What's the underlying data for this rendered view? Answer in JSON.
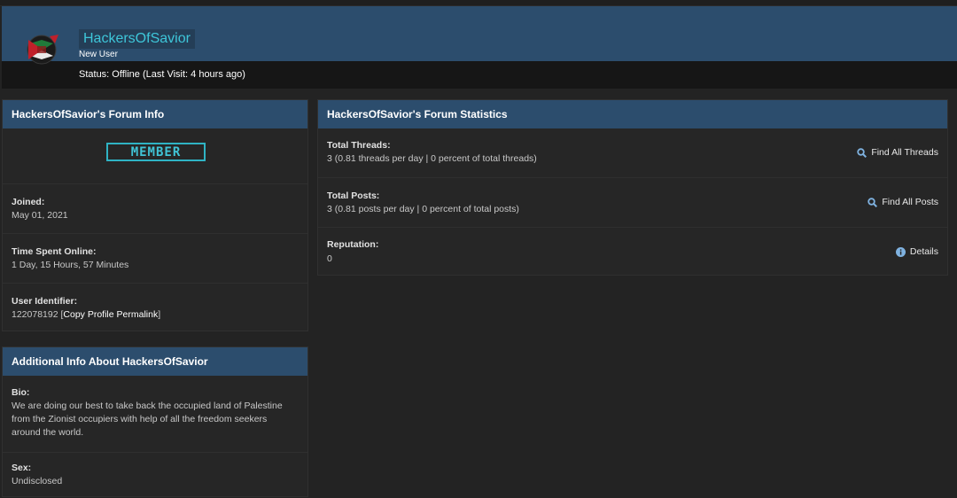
{
  "profile": {
    "username": "HackersOfSavior",
    "user_title": "New User",
    "status": "Status: Offline (Last Visit: 4 hours ago)",
    "avatar_icon": "palestine-flag-emblem-icon"
  },
  "forum_info": {
    "title": "HackersOfSavior's Forum Info",
    "rank": "MEMBER",
    "joined_label": "Joined:",
    "joined_value": "May 01, 2021",
    "online_label": "Time Spent Online:",
    "online_value": "1 Day, 15 Hours, 57 Minutes",
    "uid_label": "User Identifier:",
    "uid_value": "122078192",
    "uid_bracket_open": "[",
    "uid_link": "Copy Profile Permalink",
    "uid_bracket_close": "]"
  },
  "additional_info": {
    "title": "Additional Info About HackersOfSavior",
    "bio_label": "Bio:",
    "bio_line1": "We are doing our best to take back the occupied land of Palestine",
    "bio_line2": "from the Zionist occupiers with help of all the freedom seekers",
    "bio_line3": "around the world.",
    "sex_label": "Sex:",
    "sex_value": "Undisclosed"
  },
  "statistics": {
    "title": "HackersOfSavior's Forum Statistics",
    "threads_label": "Total Threads:",
    "threads_value": "3 (0.81 threads per day | 0 percent of total threads)",
    "threads_action": "Find All Threads",
    "posts_label": "Total Posts:",
    "posts_value": "3 (0.81 posts per day | 0 percent of total posts)",
    "posts_action": "Find All Posts",
    "rep_label": "Reputation:",
    "rep_value": "0",
    "rep_action": "Details"
  },
  "colors": {
    "header_blue": "#2c4d6d",
    "username_cyan": "#3ec6d9",
    "background": "#232323"
  }
}
